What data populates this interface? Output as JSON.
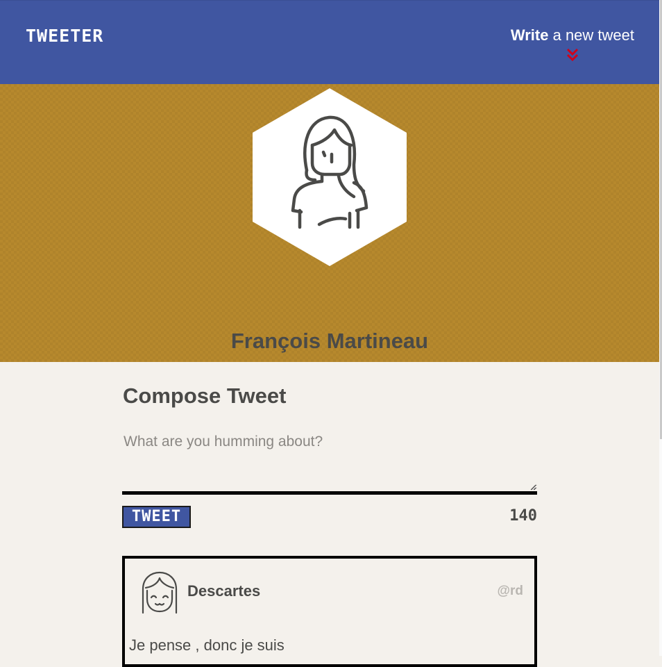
{
  "nav": {
    "brand": "TWEETER",
    "compose_strong": "Write",
    "compose_rest": " a new tweet",
    "accent_color": "#4056a1",
    "chevron_color": "#d0021b"
  },
  "header": {
    "profile_name": "François Martineau",
    "background_color": "#b7892d"
  },
  "compose": {
    "title": "Compose Tweet",
    "placeholder": "What are you humming about?",
    "button_label": "TWEET",
    "counter": "140"
  },
  "tweets": [
    {
      "author": "Descartes",
      "handle": "@rd",
      "content": "Je pense , donc je suis"
    }
  ]
}
